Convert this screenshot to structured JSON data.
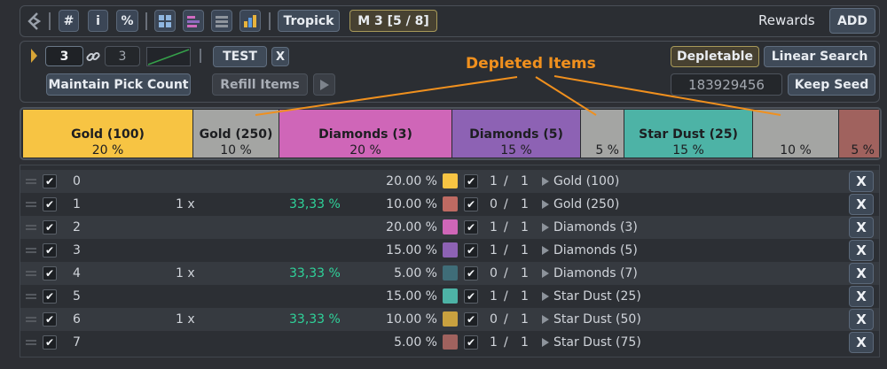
{
  "toolbar": {
    "hash_label": "#",
    "info_label": "i",
    "percent_label": "%",
    "tropick_label": "Tropick",
    "mode_label": "M 3 [5 / 8]",
    "rewards_label": "Rewards",
    "add_label": "ADD"
  },
  "controls": {
    "pick_count": "3",
    "linked_count": "3",
    "test_label": "TEST",
    "test_close_label": "X",
    "maintain_label": "Maintain Pick Count",
    "refill_label": "Refill Items",
    "depletable_label": "Depletable",
    "linear_search_label": "Linear Search",
    "seed_value": "183929456",
    "keep_seed_label": "Keep Seed"
  },
  "annotation": {
    "text": "Depleted Items",
    "color": "#f0901e"
  },
  "bar": [
    {
      "name": "Gold (100)",
      "pct": "20 %",
      "color": "#f7c443"
    },
    {
      "name": "Gold (250)",
      "pct": "10 %",
      "color": "#a4a5a3"
    },
    {
      "name": "Diamonds (3)",
      "pct": "20 %",
      "color": "#cf66b8"
    },
    {
      "name": "Diamonds (5)",
      "pct": "15 %",
      "color": "#8d62b4"
    },
    {
      "name": "",
      "pct": "5 %",
      "color": "#a4a5a3"
    },
    {
      "name": "Star Dust (25)",
      "pct": "15 %",
      "color": "#4db3a6"
    },
    {
      "name": "",
      "pct": "10 %",
      "color": "#a4a5a3"
    },
    {
      "name": "",
      "pct": "5 %",
      "color": "#a0625e"
    }
  ],
  "rows": [
    {
      "index": "0",
      "times": "",
      "chance": "",
      "weight": "20.00 %",
      "color": "#f7c443",
      "count": "1",
      "sep": "/",
      "max": "1",
      "name": "Gold (100)",
      "x": "X"
    },
    {
      "index": "1",
      "times": "1 x",
      "chance": "33,33 %",
      "weight": "10.00 %",
      "color": "#be6a62",
      "count": "0",
      "sep": "/",
      "max": "1",
      "name": "Gold (250)",
      "x": "X"
    },
    {
      "index": "2",
      "times": "",
      "chance": "",
      "weight": "20.00 %",
      "color": "#cf66b8",
      "count": "1",
      "sep": "/",
      "max": "1",
      "name": "Diamonds (3)",
      "x": "X"
    },
    {
      "index": "3",
      "times": "",
      "chance": "",
      "weight": "15.00 %",
      "color": "#8d62b4",
      "count": "1",
      "sep": "/",
      "max": "1",
      "name": "Diamonds (5)",
      "x": "X"
    },
    {
      "index": "4",
      "times": "1 x",
      "chance": "33,33 %",
      "weight": "5.00 %",
      "color": "#3f6d78",
      "count": "0",
      "sep": "/",
      "max": "1",
      "name": "Diamonds (7)",
      "x": "X"
    },
    {
      "index": "5",
      "times": "",
      "chance": "",
      "weight": "15.00 %",
      "color": "#4db3a6",
      "count": "1",
      "sep": "/",
      "max": "1",
      "name": "Star Dust (25)",
      "x": "X"
    },
    {
      "index": "6",
      "times": "1 x",
      "chance": "33,33 %",
      "weight": "10.00 %",
      "color": "#c9a13f",
      "count": "0",
      "sep": "/",
      "max": "1",
      "name": "Star Dust (50)",
      "x": "X"
    },
    {
      "index": "7",
      "times": "",
      "chance": "",
      "weight": "5.00 %",
      "color": "#a0625e",
      "count": "1",
      "sep": "/",
      "max": "1",
      "name": "Star Dust (75)",
      "x": "X"
    }
  ]
}
